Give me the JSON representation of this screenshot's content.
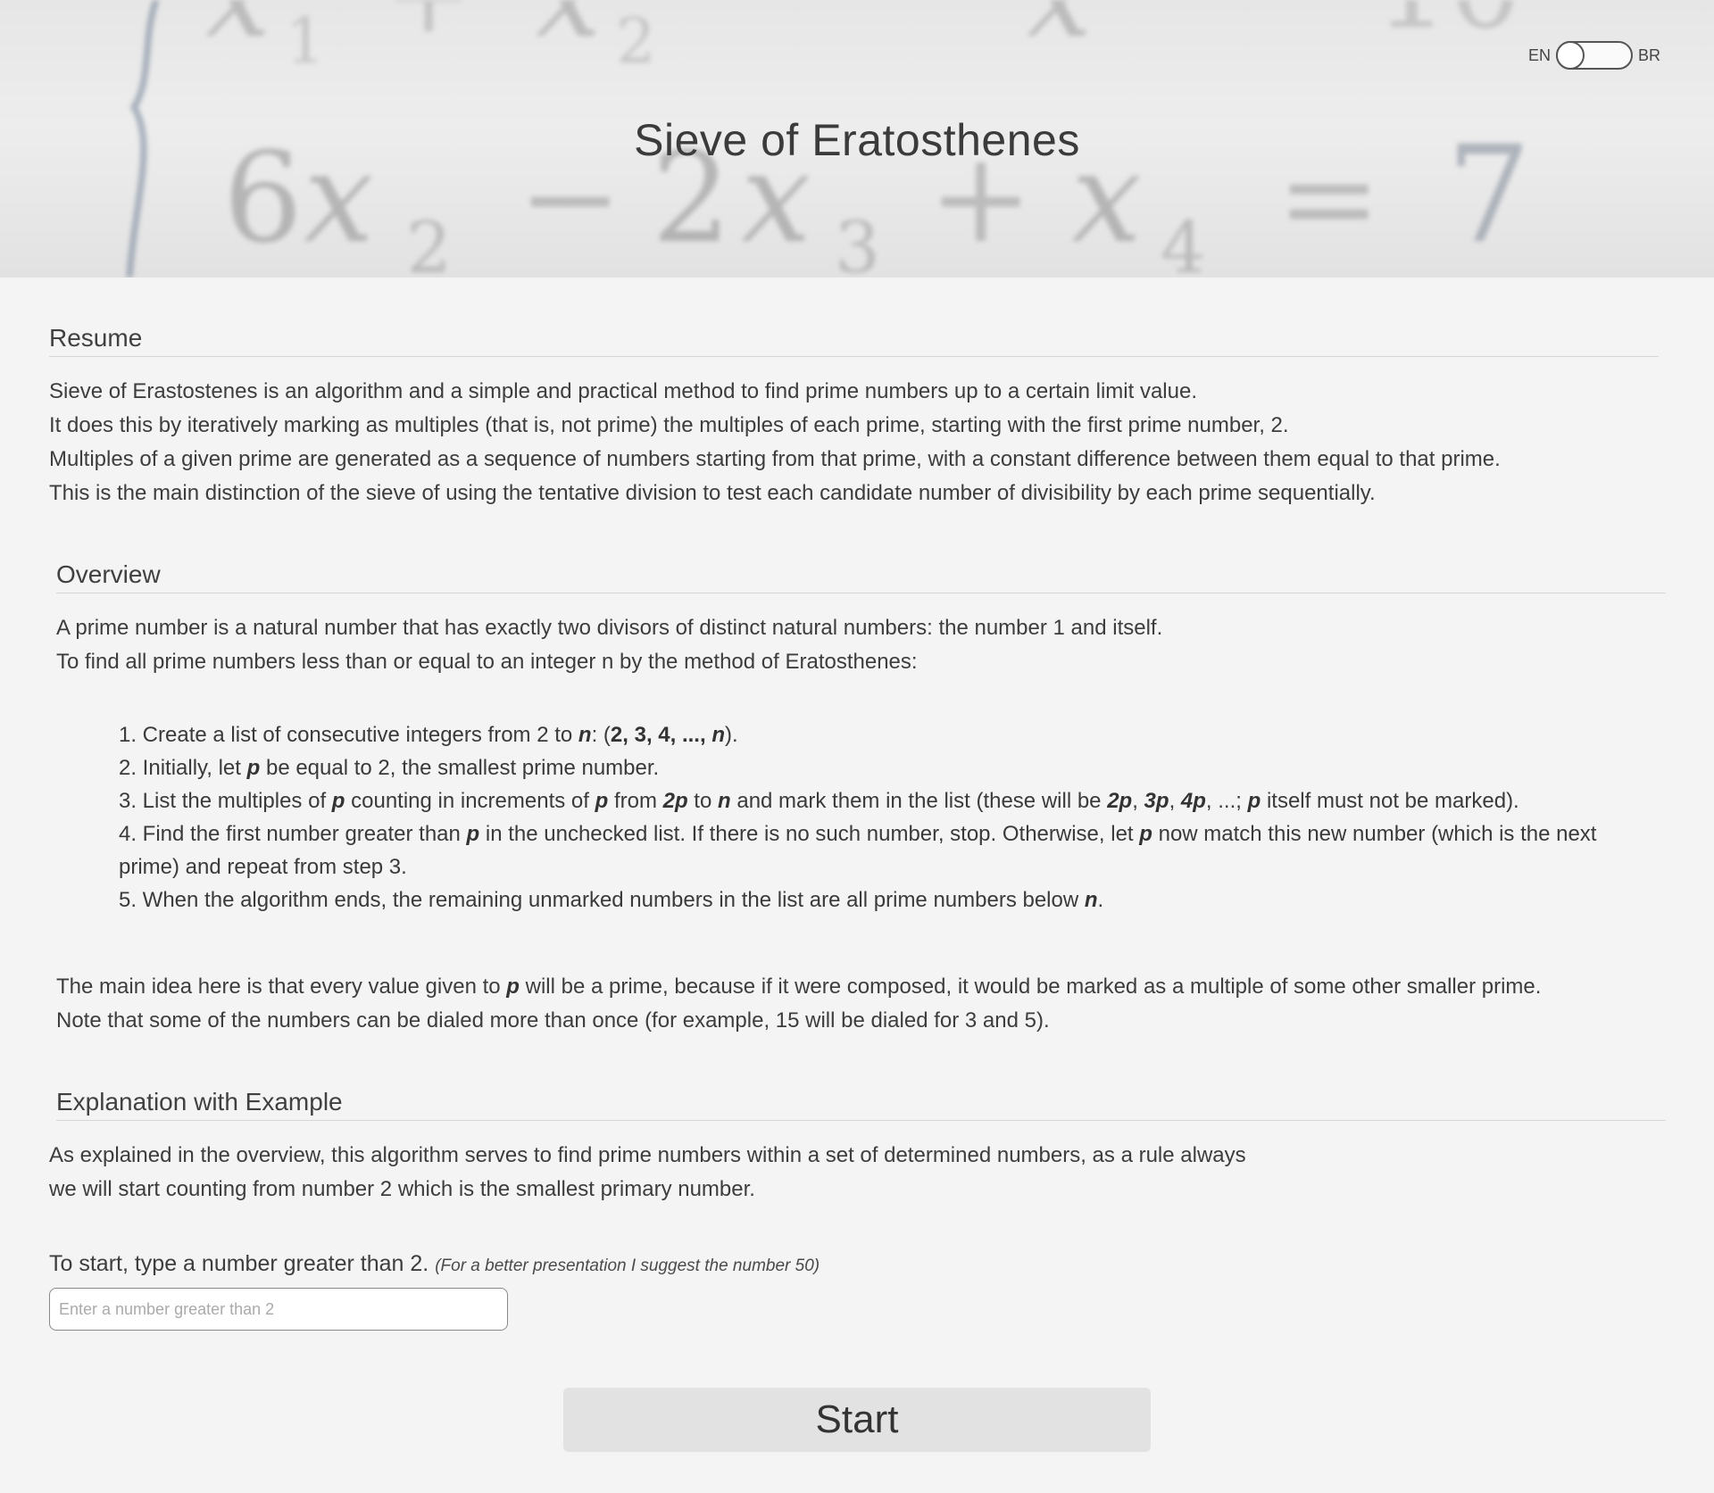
{
  "header": {
    "title": "Sieve of Eratosthenes",
    "lang_left": "EN",
    "lang_right": "BR"
  },
  "resume": {
    "heading": "Resume",
    "lines": [
      "Sieve of Erastostenes is an algorithm and a simple and practical method to find prime numbers up to a certain limit value.",
      "It does this by iteratively marking as multiples (that is, not prime) the multiples of each prime, starting with the first prime number, 2.",
      "Multiples of a given prime are generated as a sequence of numbers starting from that prime, with a constant difference between them equal to that prime.",
      "This is the main distinction of the sieve of using the tentative division to test each candidate number of divisibility by each prime sequentially."
    ]
  },
  "overview": {
    "heading": "Overview",
    "lines": [
      "A prime number is a natural number that has exactly two divisors of distinct natural numbers: the number 1 and itself.",
      "To find all prime numbers less than or equal to an integer n by the method of Eratosthenes:"
    ],
    "steps": {
      "s1_a": "1. Create a list of consecutive integers from 2 to ",
      "s1_n": "n",
      "s1_b": ": (",
      "s1_c": "2, 3, 4, ..., ",
      "s1_d": ").",
      "s2_a": "2. Initially, let ",
      "s2_p": "p",
      "s2_b": " be equal to 2, the smallest prime number.",
      "s3_a": "3. List the multiples of ",
      "s3_b": " counting in increments of ",
      "s3_c": " from ",
      "s3_2p": "2p",
      "s3_d": " to ",
      "s3_e": " and mark them in the list (these will be ",
      "s3_3p": "3p",
      "s3_4p": "4p",
      "s3_f": ", ...; ",
      "s3_g": " itself must not be marked).",
      "comma": ", ",
      "s4_a": "4. Find the first number greater than ",
      "s4_b": " in the unchecked list. If there is no such number, stop. Otherwise, let ",
      "s4_c": " now match this new number (which is the next prime) and repeat from step 3.",
      "s5_a": "5. When the algorithm ends, the remaining unmarked numbers in the list are all prime numbers below ",
      "s5_b": "."
    },
    "note_a": "The main idea here is that every value given to ",
    "note_b": " will be a prime, because if it were composed, it would be marked as a multiple of some other smaller prime.",
    "note_line2": "Note that some of the numbers can be dialed more than once (for example, 15 will be dialed for 3 and 5)."
  },
  "example": {
    "heading": "Explanation with Example",
    "line1": "As explained in the overview, this algorithm serves to find prime numbers within a set of determined numbers, as a rule always",
    "line2": "we will start counting from number 2 which is the smallest primary number.",
    "prompt": "To start, type a number greater than 2.",
    "hint": "(For a better presentation I suggest the number 50)",
    "input_placeholder": "Enter a number greater than 2",
    "input_value": "",
    "start_label": "Start"
  }
}
